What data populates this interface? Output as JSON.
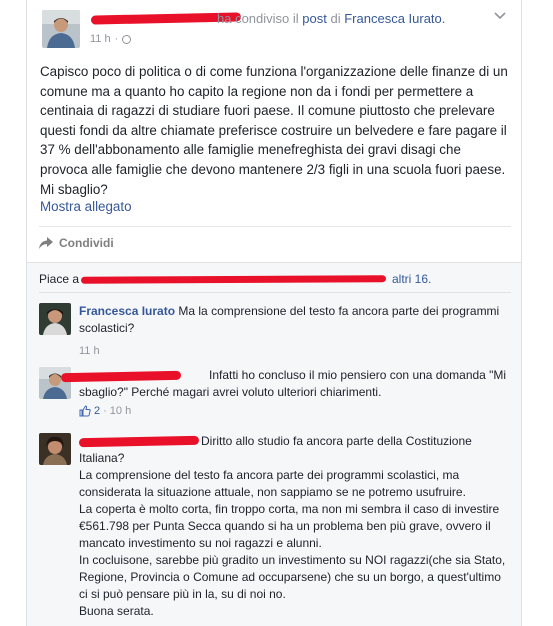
{
  "post": {
    "header_suffix": "ha condiviso il",
    "post_link": "post",
    "of_text": "di",
    "shared_author": "Francesca Iurato.",
    "time": "11 h",
    "body": "Capisco poco di politica o di come funziona l'organizzazione delle finanze di un comune ma a quanto ho capito la regione non da i fondi per permettere a centinaia di ragazzi di studiare fuori paese. Il comune piuttosto che prelevare questi fondi da altre chiamate preferisce costruire un belvedere e fare pagare il 37 % dell'abbonamento alle famiglie menefreghista dei gravi disagi che provoca alle famiglie che devono mantenere 2/3 figli in una scuola fuori paese. Mi sbaglio?",
    "show_attachment": "Mostra allegato",
    "share_label": "Condividi"
  },
  "likes": {
    "prefix": "Piace a",
    "others": "altri 16."
  },
  "comments": [
    {
      "author": "Francesca Iurato",
      "text": "Ma la comprensione del testo fa ancora parte dei programmi scolastici?",
      "time": "11 h"
    },
    {
      "author": "",
      "text": "Infatti ho concluso il mio pensiero con una domanda \"Mi sbaglio?\" Perché magari avrei voluto ulteriori chiarimenti.",
      "like_count": "2",
      "time": "10 h"
    },
    {
      "author": "",
      "lines": [
        "Diritto allo studio fa ancora parte della Costituzione Italiana?",
        "La comprensione del testo fa ancora parte dei programmi scolastici, ma considerata la situazione attuale, non sappiamo se ne potremo usufruire.",
        "La coperta è molto corta, fin troppo corta, ma non mi sembra il caso di investire €561.798 per Punta Secca quando si ha un problema ben più grave, ovvero il mancato investimento su noi ragazzi e alunni.",
        "In cocluisone, sarebbe più gradito un investimento su NOI ragazzi(che sia Stato, Regione, Provincia o Comune ad occuparsene) che su un borgo, a quest'ultimo ci si può pensare più in la, su di noi no.",
        "Buona serata."
      ]
    }
  ],
  "colors": {
    "link": "#365899",
    "muted": "#90949c",
    "redaction": "#e9102a",
    "comments_bg": "#f6f7f9"
  },
  "icons": [
    "chevron-down-icon",
    "globe-icon",
    "share-icon",
    "thumbs-up-icon"
  ]
}
